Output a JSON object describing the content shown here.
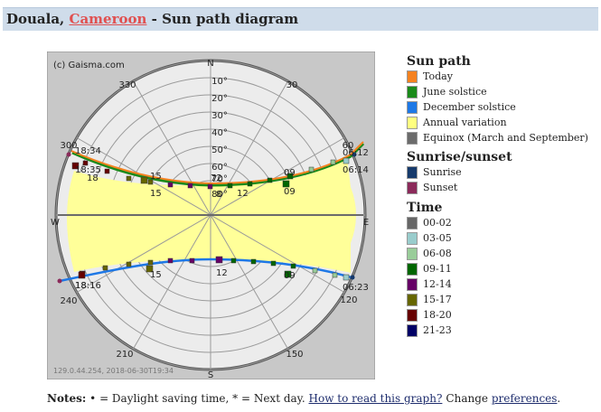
{
  "header": {
    "city": "Douala,",
    "country_link": "Cameroon",
    "suffix": "- Sun path diagram"
  },
  "diagram": {
    "copyright": "(c) Gaisma.com",
    "footer_stamp": "129.0.44.254, 2018-06-30T19:34",
    "compass": {
      "n": "N",
      "s": "S",
      "e": "E",
      "w": "W"
    },
    "azimuth_labels": [
      "330",
      "30",
      "300",
      "60",
      "240",
      "120",
      "210",
      "150"
    ],
    "altitude_labels": [
      "10°",
      "20°",
      "30°",
      "40°",
      "50°",
      "60°",
      "70°",
      "80°"
    ],
    "time_labels": {
      "today_sunset": "18:34",
      "june_sunset": "18:35",
      "dec_sunset": "18:16",
      "today_sunrise": "06:12",
      "june_sunrise": "06:14",
      "dec_sunrise": "06:23",
      "h18a": "18",
      "h18b": "18",
      "h15a": "15",
      "h15b": "15",
      "h15c": "15",
      "h12a": "12",
      "h12b": "12",
      "h09a": "09",
      "h09b": "09",
      "h09c": "09",
      "h72": "72",
      "h8": "8"
    },
    "colors": {
      "today": "#f58220",
      "june": "#1a8a1a",
      "december": "#1e78e6",
      "annual": "#ffff99",
      "equinox": "#6b6b6b"
    }
  },
  "legend": {
    "sun_path": {
      "title": "Sun path",
      "items": [
        {
          "label": "Today",
          "color": "#f58220"
        },
        {
          "label": "June solstice",
          "color": "#1a8a1a"
        },
        {
          "label": "December solstice",
          "color": "#1e78e6"
        },
        {
          "label": "Annual variation",
          "color": "#ffff80"
        },
        {
          "label": "Equinox (March and September)",
          "color": "#6b6b6b"
        }
      ]
    },
    "sunrise_sunset": {
      "title": "Sunrise/sunset",
      "items": [
        {
          "label": "Sunrise",
          "color": "#163a6b"
        },
        {
          "label": "Sunset",
          "color": "#8b2a5a"
        }
      ]
    },
    "time": {
      "title": "Time",
      "items": [
        {
          "label": "00-02",
          "color": "#666666"
        },
        {
          "label": "03-05",
          "color": "#99cccc"
        },
        {
          "label": "06-08",
          "color": "#99cc99"
        },
        {
          "label": "09-11",
          "color": "#006600"
        },
        {
          "label": "12-14",
          "color": "#660066"
        },
        {
          "label": "15-17",
          "color": "#666600"
        },
        {
          "label": "18-20",
          "color": "#660000"
        },
        {
          "label": "21-23",
          "color": "#000066"
        }
      ]
    }
  },
  "notes": {
    "label": "Notes:",
    "text": "• = Daylight saving time, * = Next day.",
    "link1": "How to read this graph?",
    "middle": "Change",
    "link2": "preferences",
    "end": "."
  }
}
